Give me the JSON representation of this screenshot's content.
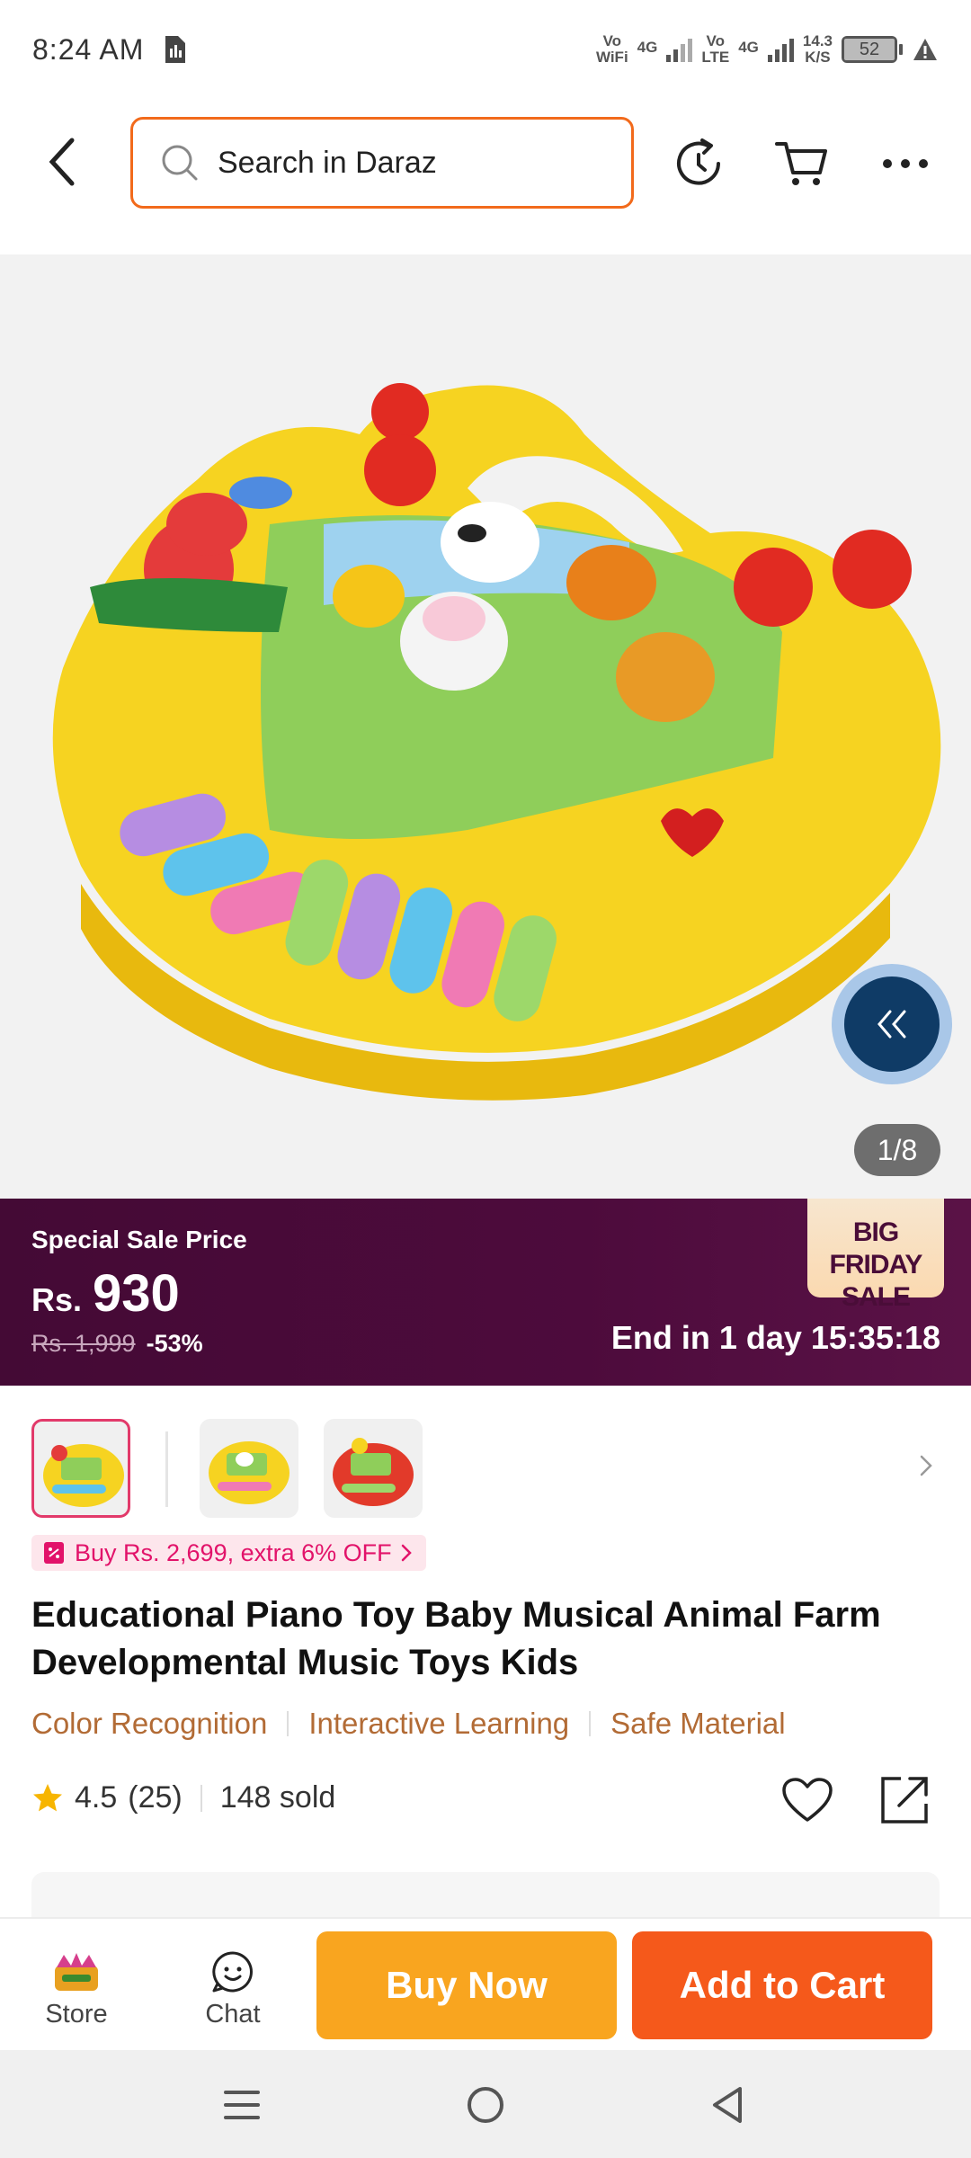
{
  "status_bar": {
    "time": "8:24 AM",
    "wifi_label_top": "Vo",
    "wifi_label_bottom": "WiFi",
    "net1": "4G",
    "lte_top": "Vo",
    "lte_bottom": "LTE",
    "net2": "4G",
    "speed_top": "14.3",
    "speed_bottom": "K/S",
    "battery": "52"
  },
  "header": {
    "search_placeholder": "Search in Daraz"
  },
  "gallery": {
    "counter": "1/8"
  },
  "sale": {
    "label": "Special Sale Price",
    "currency": "Rs.",
    "price": "930",
    "original_price": "Rs. 1,999",
    "discount": "-53%",
    "badge_line1": "BIG FRIDAY",
    "badge_line2": "SALE",
    "countdown": "End in 1 day 15:35:18"
  },
  "promo": {
    "text": "Buy Rs. 2,699, extra 6% OFF"
  },
  "product": {
    "title": "Educational Piano Toy Baby Musical Animal Farm Developmental Music Toys Kids",
    "tags": [
      "Color Recognition",
      "Interactive Learning",
      "Safe Material"
    ],
    "rating": "4.5",
    "reviews": "(25)",
    "sold": "148 sold"
  },
  "action_bar": {
    "store_label": "Store",
    "chat_label": "Chat",
    "buy_now": "Buy Now",
    "add_to_cart": "Add to Cart"
  },
  "colors": {
    "accent": "#f5591b",
    "buy_now": "#f9a51f",
    "sale_bg": "#440a35",
    "tag_text": "#b26b35",
    "promo_text": "#e2136a"
  }
}
